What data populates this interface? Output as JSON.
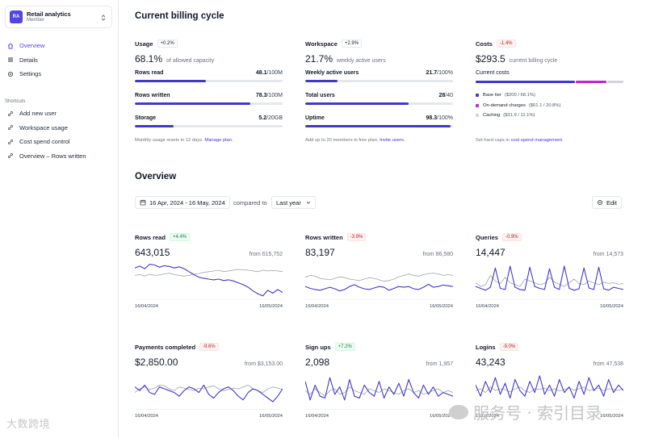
{
  "sidebar": {
    "org": {
      "initials": "RA",
      "name": "Retail analytics",
      "role": "Member"
    },
    "nav": [
      {
        "label": "Overview",
        "icon": "home-icon",
        "active": true
      },
      {
        "label": "Details",
        "icon": "list-icon",
        "active": false
      },
      {
        "label": "Settings",
        "icon": "gear-icon",
        "active": false
      }
    ],
    "shortcuts_title": "Shortcuts",
    "shortcuts": [
      {
        "label": "Add new user",
        "icon": "link-icon"
      },
      {
        "label": "Workspace usage",
        "icon": "link-icon"
      },
      {
        "label": "Cost spend control",
        "icon": "link-icon"
      },
      {
        "label": "Overview – Rows written",
        "icon": "link-icon"
      }
    ]
  },
  "billing": {
    "title": "Current billing cycle",
    "usage": {
      "title": "Usage",
      "badge": "+0.2%",
      "value": "68.1%",
      "unit": "of allowed capacity",
      "meters": [
        {
          "label": "Rows read",
          "value": "48.1",
          "total": "/100M",
          "fraction": 0.481
        },
        {
          "label": "Rows written",
          "value": "78.3",
          "total": "/100M",
          "fraction": 0.783
        },
        {
          "label": "Storage",
          "value": "5.2",
          "total": "/20GB",
          "fraction": 0.26
        }
      ],
      "footer_text": "Monthly usage resets in 12 days. ",
      "footer_link": "Manage plan."
    },
    "workspace": {
      "title": "Workspace",
      "badge": "+2.9%",
      "value": "21.7%",
      "unit": "weekly active users",
      "meters": [
        {
          "label": "Weekly active users",
          "value": "21.7",
          "total": "/100%",
          "fraction": 0.217
        },
        {
          "label": "Total users",
          "value": "28",
          "total": "/40",
          "fraction": 0.7
        },
        {
          "label": "Uptime",
          "value": "98.3",
          "total": "/100%",
          "fraction": 0.983
        }
      ],
      "footer_text": "Add up to 20 members in free plan. ",
      "footer_link": "Invite users."
    },
    "costs": {
      "title": "Costs",
      "badge": "-1.4%",
      "value": "$293.5",
      "unit": "current billing cycle",
      "subtitle": "Current costs",
      "segments": [
        {
          "share": 0.681,
          "color": "#4338ca"
        },
        {
          "share": 0.208,
          "color": "#c026d3"
        },
        {
          "share": 0.111,
          "color": "#d1d5db"
        }
      ],
      "items": [
        {
          "label": "Base tier",
          "detail": "($200 / 68.1%)",
          "color": "#4338ca"
        },
        {
          "label": "On-demand charges",
          "detail": "($61.1 / 20.8%)",
          "color": "#c026d3"
        },
        {
          "label": "Caching",
          "detail": "($31.9 / 11.1%)",
          "color": "#d1d5db"
        }
      ],
      "footer_text": "Set hard caps in ",
      "footer_link": "cost spend management."
    }
  },
  "overview": {
    "title": "Overview",
    "date_range": "16 Apr, 2024 - 16 May, 2024",
    "compare_label": "compared to",
    "compare_value": "Last year",
    "edit_label": "Edit"
  },
  "colors": {
    "primary": "#4338ca",
    "compare": "#9ca3af",
    "accent": "#c026d3"
  },
  "chart_data": [
    {
      "type": "line",
      "title": "Rows read",
      "badge": "+4.4%",
      "badge_kind": "pos",
      "value": "643,015",
      "from": "from 615,752",
      "x_start": "16/04/2024",
      "x_end": "16/05/2024",
      "series": [
        {
          "values": [
            80,
            85,
            78,
            90,
            88,
            82,
            86,
            84,
            80,
            83,
            78,
            70,
            62,
            55,
            52,
            50,
            48,
            50,
            46,
            48,
            45,
            40,
            35,
            28,
            18,
            10,
            5,
            20,
            12,
            22,
            14
          ]
        },
        {
          "values": [
            60,
            62,
            58,
            63,
            60,
            61,
            64,
            66,
            62,
            60,
            58,
            60,
            63,
            65,
            68,
            70,
            72,
            74,
            70,
            72,
            74,
            76,
            75,
            74,
            72,
            70,
            74,
            72,
            73,
            72,
            70
          ]
        }
      ]
    },
    {
      "type": "line",
      "title": "Rows written",
      "badge": "-3.9%",
      "badge_kind": "neg",
      "value": "83,197",
      "from": "from 86,580",
      "x_start": "16/04/2024",
      "x_end": "16/05/2024",
      "series": [
        {
          "values": [
            30,
            25,
            22,
            20,
            24,
            28,
            24,
            18,
            22,
            30,
            35,
            28,
            24,
            22,
            26,
            30,
            28,
            20,
            25,
            30,
            28,
            30,
            24,
            22,
            28,
            36,
            28,
            30,
            34,
            32,
            30
          ]
        },
        {
          "values": [
            55,
            60,
            58,
            52,
            50,
            48,
            52,
            56,
            54,
            50,
            48,
            46,
            50,
            54,
            52,
            48,
            44,
            46,
            50,
            56,
            60,
            64,
            60,
            58,
            62,
            65,
            66,
            64,
            60,
            62,
            60
          ]
        }
      ]
    },
    {
      "type": "line",
      "title": "Queries",
      "badge": "-0.9%",
      "badge_kind": "neg",
      "value": "14,447",
      "from": "from 14,573",
      "x_start": "16/04/2024",
      "x_end": "16/05/2024",
      "series": [
        {
          "values": [
            30,
            25,
            20,
            28,
            80,
            25,
            22,
            85,
            28,
            22,
            20,
            82,
            30,
            25,
            22,
            78,
            28,
            22,
            85,
            25,
            20,
            24,
            80,
            26,
            22,
            82,
            24,
            20,
            28,
            25,
            22
          ]
        },
        {
          "values": [
            40,
            30,
            35,
            60,
            45,
            38,
            55,
            40,
            35,
            30,
            50,
            45,
            40,
            35,
            38,
            55,
            42,
            36,
            30,
            40,
            50,
            38,
            35,
            45,
            40,
            35,
            42,
            38,
            40,
            36,
            38
          ]
        }
      ]
    },
    {
      "type": "line",
      "title": "Payments completed",
      "badge": "-9.6%",
      "badge_kind": "neg",
      "value": "$2,850.00",
      "from": "from $3,153.00",
      "x_start": "16/04/2024",
      "x_end": "16/05/2024",
      "series": [
        {
          "values": [
            55,
            45,
            60,
            40,
            35,
            55,
            50,
            45,
            40,
            30,
            45,
            55,
            50,
            40,
            60,
            35,
            25,
            40,
            50,
            55,
            45,
            30,
            20,
            40,
            50,
            45,
            35,
            25,
            15,
            30,
            50
          ]
        },
        {
          "values": [
            40,
            50,
            55,
            48,
            52,
            60,
            58,
            50,
            45,
            55,
            52,
            48,
            45,
            52,
            50,
            55,
            58,
            50,
            45,
            48,
            52,
            50,
            55,
            60,
            50,
            45,
            40,
            50,
            55,
            52,
            48
          ]
        }
      ]
    },
    {
      "type": "line",
      "title": "Sign ups",
      "badge": "+7.2%",
      "badge_kind": "pos",
      "value": "2,098",
      "from": "from 1,957",
      "x_start": "16/04/2024",
      "x_end": "16/05/2024",
      "series": [
        {
          "values": [
            70,
            20,
            60,
            30,
            25,
            80,
            35,
            55,
            20,
            75,
            30,
            25,
            60,
            40,
            30,
            70,
            25,
            55,
            35,
            65,
            30,
            75,
            40,
            25,
            60,
            35,
            55,
            30,
            40,
            35,
            30
          ]
        },
        {
          "values": [
            45,
            35,
            50,
            40,
            30,
            45,
            50,
            35,
            40,
            55,
            45,
            40,
            35,
            50,
            45,
            40,
            50,
            45,
            40,
            35,
            45,
            50,
            40,
            45,
            35,
            40,
            45,
            50,
            40,
            45,
            40
          ]
        }
      ]
    },
    {
      "type": "line",
      "title": "Logins",
      "badge": "-9.0%",
      "badge_kind": "neg",
      "value": "43,243",
      "from": "from 47,538",
      "x_start": "16/04/2024",
      "x_end": "16/05/2024",
      "series": [
        {
          "values": [
            60,
            30,
            70,
            40,
            80,
            35,
            65,
            25,
            75,
            45,
            30,
            70,
            40,
            85,
            35,
            60,
            30,
            75,
            40,
            55,
            25,
            70,
            35,
            80,
            45,
            60,
            30,
            75,
            40,
            60,
            45
          ]
        },
        {
          "values": [
            45,
            50,
            40,
            55,
            45,
            50,
            48,
            42,
            50,
            55,
            45,
            40,
            50,
            48,
            52,
            45,
            50,
            44,
            48,
            52,
            46,
            50,
            55,
            45,
            48,
            52,
            45,
            50,
            48,
            46,
            50
          ]
        }
      ]
    }
  ],
  "watermark_left": "大数跨境",
  "watermark_right": "服务号 · 索引目录"
}
